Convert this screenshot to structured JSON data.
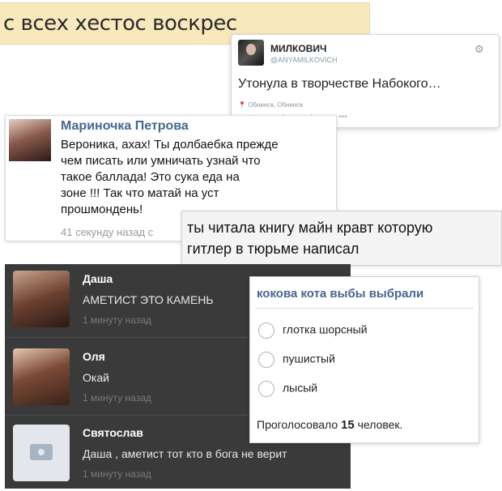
{
  "strip": {
    "text": "с всех хестос воскрес"
  },
  "tweet": {
    "name": "МИЛКОВИЧ",
    "handle": "@ANYAMILKOVICH",
    "text": "Утонула в творчестве Набокого…",
    "location": "Обнинск, Обнинск"
  },
  "vk_post": {
    "author": "Мариночка Петрова",
    "message": "Вероника, ахах! Ты долбаебка прежде\nчем писать или умничать узнай что\nтакое баллада! Это сука еда на\nзоне !!!  Так что матай на уст\nпрошмондень!",
    "time": "41 секунду назад с"
  },
  "hitler_card": {
    "line1": "ты читала книгу майн кравт которую",
    "line2": "гитлер в тюрьме написал"
  },
  "chat": [
    {
      "name": "Даша",
      "text": "АМЕТИСТ ЭТО КАМЕНЬ",
      "time": "1 минуту назад"
    },
    {
      "name": "Оля",
      "text": "Окай",
      "time": "1 минуту назад"
    },
    {
      "name": "Святослав",
      "text": "Даша , аметист тот кто в бога не верит",
      "time": "1 минуту назад"
    }
  ],
  "poll": {
    "question": "кокова кота выбы выбрали",
    "options": [
      "глотка шорсный",
      "пушистый",
      "лысый"
    ],
    "total_prefix": "Проголосовало",
    "total_count": "15",
    "total_suffix": "человек."
  },
  "icons": {
    "gear": "gear-icon",
    "location": "location-pin-icon",
    "camera": "camera-icon"
  }
}
